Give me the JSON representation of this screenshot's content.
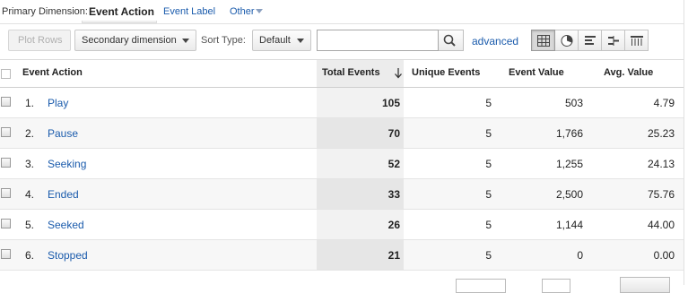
{
  "dimension_bar": {
    "label": "Primary Dimension:",
    "active": "Event Action",
    "links": [
      "Event Label",
      "Other"
    ]
  },
  "toolbar": {
    "plot_rows": "Plot Rows",
    "secondary_dimension": "Secondary dimension",
    "sort_type_label": "Sort Type:",
    "sort_type_value": "Default",
    "search_value": "",
    "advanced": "advanced"
  },
  "table": {
    "columns": [
      "Event Action",
      "Total Events",
      "Unique Events",
      "Event Value",
      "Avg. Value"
    ],
    "rows": [
      {
        "idx": "1.",
        "action": "Play",
        "total": "105",
        "unique": "5",
        "value": "503",
        "avg": "4.79"
      },
      {
        "idx": "2.",
        "action": "Pause",
        "total": "70",
        "unique": "5",
        "value": "1,766",
        "avg": "25.23"
      },
      {
        "idx": "3.",
        "action": "Seeking",
        "total": "52",
        "unique": "5",
        "value": "1,255",
        "avg": "24.13"
      },
      {
        "idx": "4.",
        "action": "Ended",
        "total": "33",
        "unique": "5",
        "value": "2,500",
        "avg": "75.76"
      },
      {
        "idx": "5.",
        "action": "Seeked",
        "total": "26",
        "unique": "5",
        "value": "1,144",
        "avg": "44.00"
      },
      {
        "idx": "6.",
        "action": "Stopped",
        "total": "21",
        "unique": "5",
        "value": "0",
        "avg": "0.00"
      }
    ]
  },
  "colors": {
    "link": "#1a5bac",
    "sorted_column": "#f2f2f2"
  }
}
